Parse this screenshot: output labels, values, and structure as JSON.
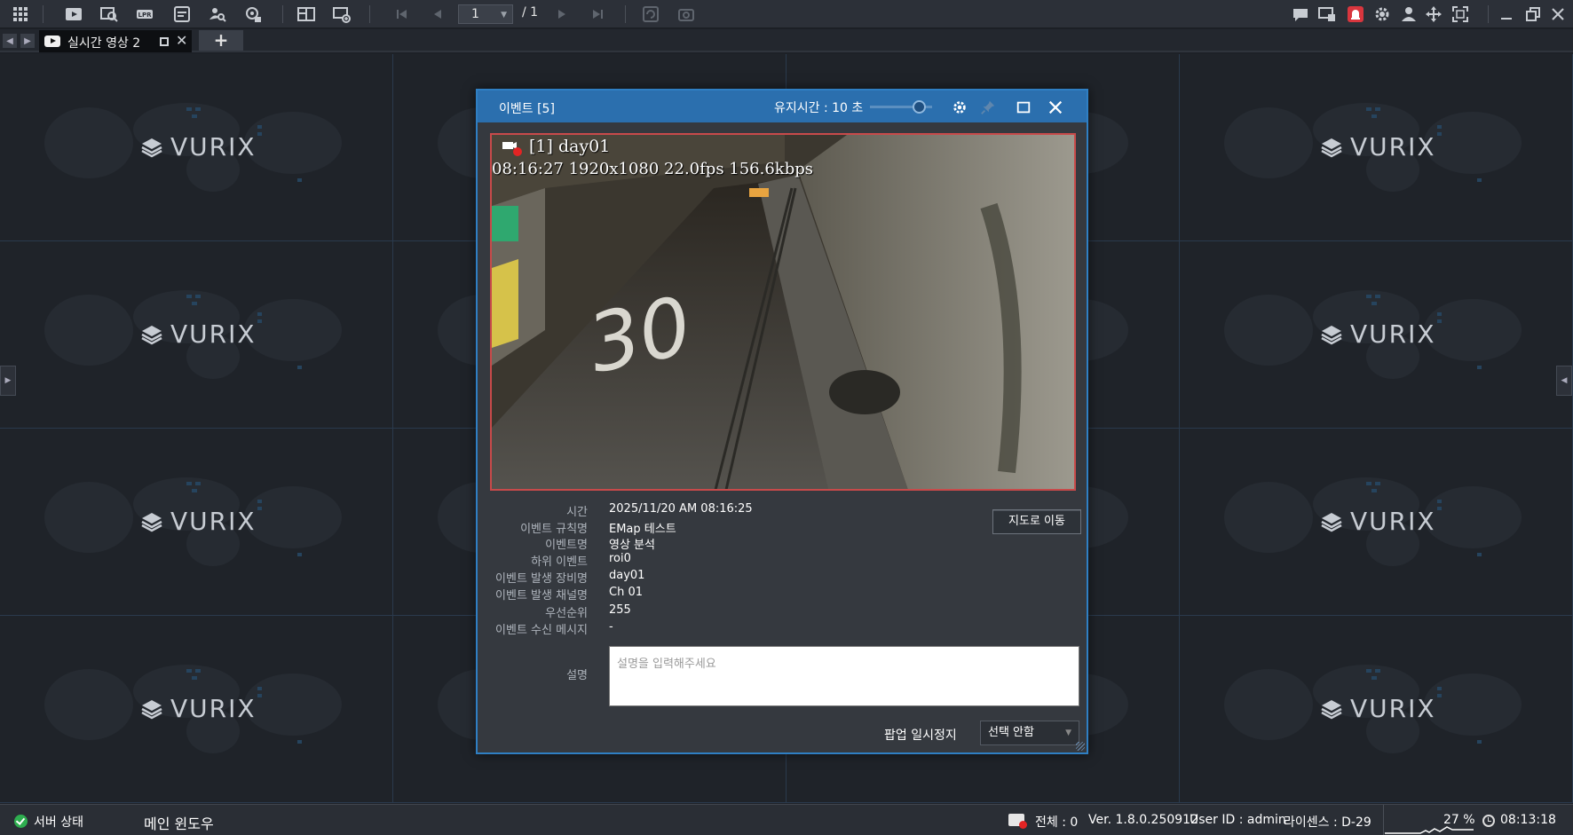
{
  "toolbar": {
    "page_current": "1",
    "page_total": "/ 1"
  },
  "tab": {
    "label": "실시간 영상 2",
    "add": "+"
  },
  "grid": {
    "logo_text": "VURIX"
  },
  "dialog": {
    "title": "이벤트 [5]",
    "keep_label": "유지시간 : 10 초",
    "video_overlay_line1": "[1] day01",
    "video_overlay_line2": "08:16:27 1920x1080 22.0fps 156.6kbps",
    "fields": [
      {
        "label": "시간",
        "value": "2025/11/20 AM 08:16:25"
      },
      {
        "label": "이벤트 규칙명",
        "value": "EMap 테스트"
      },
      {
        "label": "이벤트명",
        "value": "영상 분석"
      },
      {
        "label": "하위 이벤트",
        "value": "roi0"
      },
      {
        "label": "이벤트 발생 장비명",
        "value": "day01"
      },
      {
        "label": "이벤트 발생 채널명",
        "value": "Ch 01"
      },
      {
        "label": "우선순위",
        "value": "255"
      },
      {
        "label": "이벤트 수신 메시지",
        "value": "-"
      }
    ],
    "map_button": "지도로 이동",
    "desc_label": "설명",
    "desc_placeholder": "설명을 입력해주세요",
    "pause_label": "팝업 일시정지",
    "pause_value": "선택 안함"
  },
  "statusbar": {
    "server_status": "서버 상태",
    "main_window": "메인 윈도우",
    "total": "전체 : 0",
    "version": "Ver. 1.8.0.250912",
    "user": "User ID : admin",
    "license": "라이센스 : D-29",
    "cpu": "27 %",
    "time": "08:13:18"
  },
  "colors": {
    "dialog_header": "#2b6fae",
    "video_border": "#c84a4a",
    "ok_green": "#2eae4f"
  }
}
